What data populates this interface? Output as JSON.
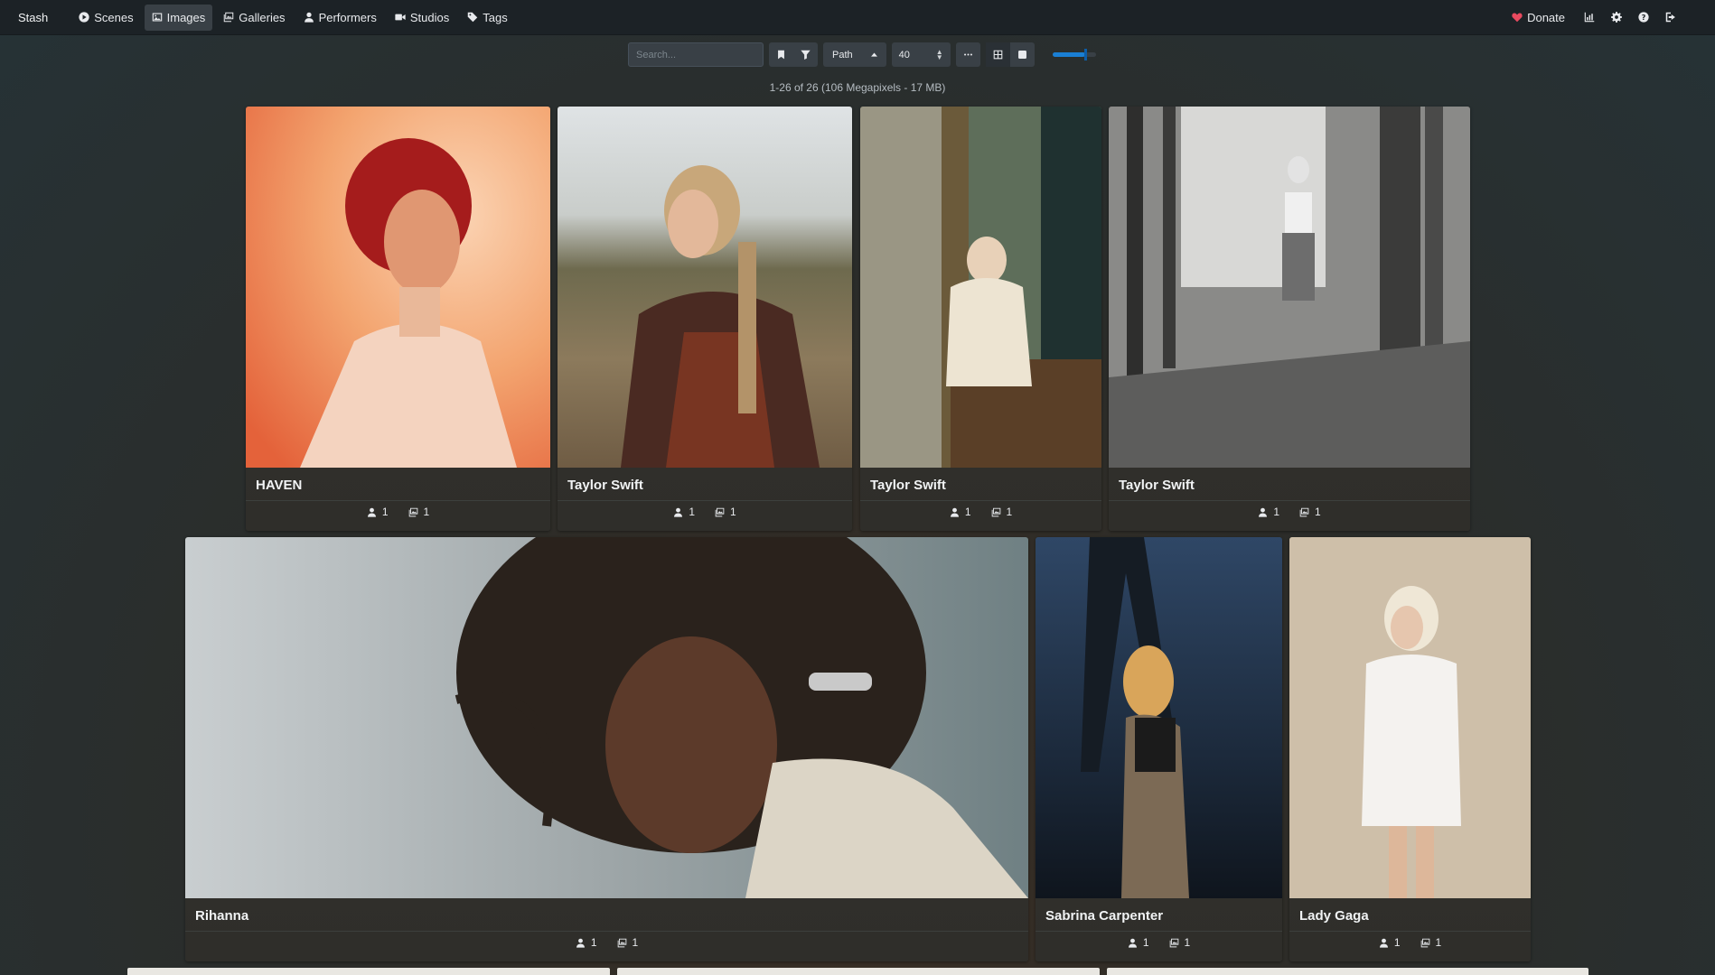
{
  "navbar": {
    "brand": "Stash",
    "items": [
      {
        "label": "Scenes",
        "icon": "play-circle-icon"
      },
      {
        "label": "Images",
        "icon": "image-icon",
        "active": true
      },
      {
        "label": "Galleries",
        "icon": "images-icon"
      },
      {
        "label": "Performers",
        "icon": "user-icon"
      },
      {
        "label": "Studios",
        "icon": "video-icon"
      },
      {
        "label": "Tags",
        "icon": "tag-icon"
      }
    ],
    "donate_label": "Donate",
    "right_icons": [
      "chart-icon",
      "gear-icon",
      "help-icon",
      "logout-icon"
    ]
  },
  "toolbar": {
    "search_placeholder": "Search...",
    "sort_by": "Path",
    "per_page": "40",
    "zoom_level": 0.75
  },
  "results_summary": "1-26 of 26 (106 Megapixels - 17 MB)",
  "cards": [
    {
      "title": "HAVEN",
      "performers": "1",
      "galleries": "1"
    },
    {
      "title": "Taylor Swift",
      "performers": "1",
      "galleries": "1"
    },
    {
      "title": "Taylor Swift",
      "performers": "1",
      "galleries": "1"
    },
    {
      "title": "Taylor Swift",
      "performers": "1",
      "galleries": "1"
    },
    {
      "title": "Rihanna",
      "performers": "1",
      "galleries": "1"
    },
    {
      "title": "Sabrina Carpenter",
      "performers": "1",
      "galleries": "1"
    },
    {
      "title": "Lady Gaga",
      "performers": "1",
      "galleries": "1"
    }
  ],
  "colors": {
    "navbar_bg": "#1c2226",
    "accent": "#1a7fd4",
    "donate_heart": "#e84a5f",
    "card_bg": "#30332f"
  }
}
